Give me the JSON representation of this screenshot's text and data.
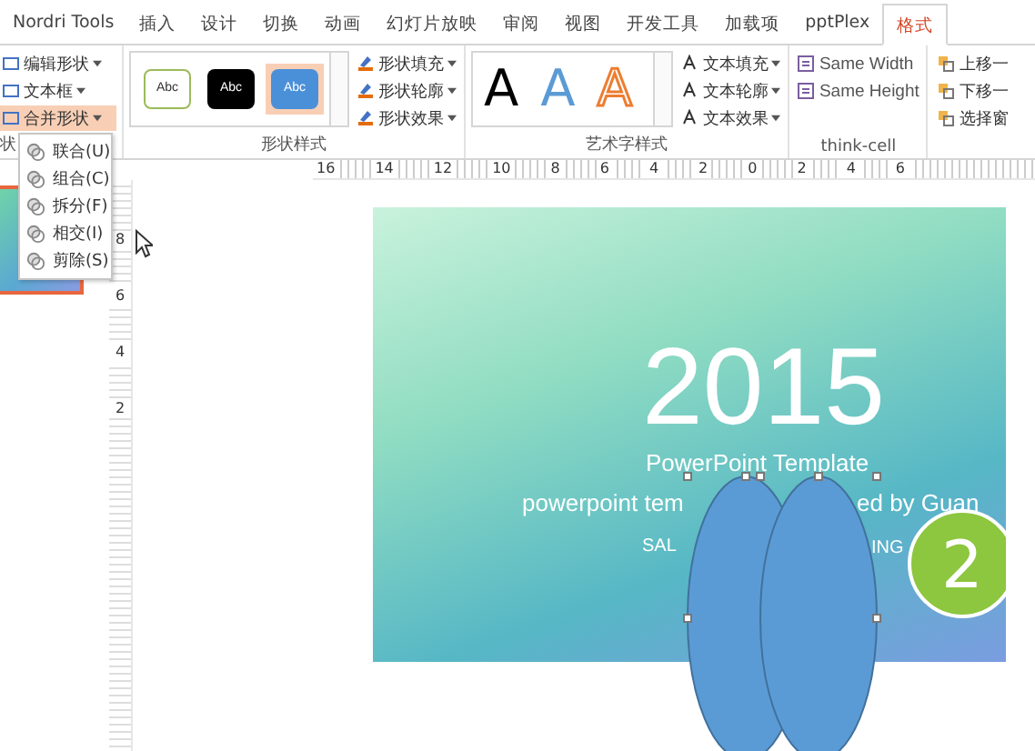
{
  "tabs": [
    {
      "label": "Nordri Tools",
      "selected": false
    },
    {
      "label": "插入",
      "selected": false
    },
    {
      "label": "设计",
      "selected": false
    },
    {
      "label": "切换",
      "selected": false
    },
    {
      "label": "动画",
      "selected": false
    },
    {
      "label": "幻灯片放映",
      "selected": false
    },
    {
      "label": "审阅",
      "selected": false
    },
    {
      "label": "视图",
      "selected": false
    },
    {
      "label": "开发工具",
      "selected": false
    },
    {
      "label": "加载项",
      "selected": false
    },
    {
      "label": "pptPlex",
      "selected": false
    },
    {
      "label": "格式",
      "selected": true
    }
  ],
  "insert_shapes": {
    "label": "状",
    "commands": [
      {
        "label": "编辑形状",
        "highlighted": false
      },
      {
        "label": "文本框",
        "highlighted": false
      },
      {
        "label": "合并形状",
        "highlighted": true
      }
    ]
  },
  "shape_styles": {
    "label": "形状样式",
    "swatches": [
      {
        "kind": "outline",
        "label": "Abc",
        "selected": false
      },
      {
        "kind": "dark",
        "label": "Abc",
        "selected": false
      },
      {
        "kind": "blue",
        "label": "Abc",
        "selected": true
      }
    ],
    "commands": [
      "形状填充",
      "形状轮廓",
      "形状效果"
    ]
  },
  "wordart_styles": {
    "label": "艺术字样式",
    "letters": [
      {
        "kind": "black",
        "label": "A"
      },
      {
        "kind": "blue",
        "label": "A"
      },
      {
        "kind": "orange",
        "label": "A"
      }
    ],
    "commands": [
      "文本填充",
      "文本轮廓",
      "文本效果"
    ]
  },
  "think_cell": {
    "label": "think-cell",
    "commands": [
      "Same Width",
      "Same Height"
    ]
  },
  "arrange": {
    "commands": [
      "上移一",
      "下移一",
      "选择窗"
    ]
  },
  "merge_menu": [
    {
      "label": "联合(U)"
    },
    {
      "label": "组合(C)"
    },
    {
      "label": "拆分(F)"
    },
    {
      "label": "相交(I)"
    },
    {
      "label": "剪除(S)"
    }
  ],
  "ruler": {
    "horizontal": [
      "16",
      "14",
      "12",
      "10",
      "8",
      "6",
      "4",
      "2",
      "0",
      "2",
      "4",
      "6"
    ],
    "vertical": [
      "8",
      "6",
      "4",
      "2"
    ]
  },
  "slide": {
    "year": "2015",
    "subtitle": "PowerPoint Template",
    "line_left": "powerpoint tem",
    "line_right": "ed by Guan",
    "caption_left": "SAL",
    "caption_right": "ING",
    "badge": "2"
  }
}
